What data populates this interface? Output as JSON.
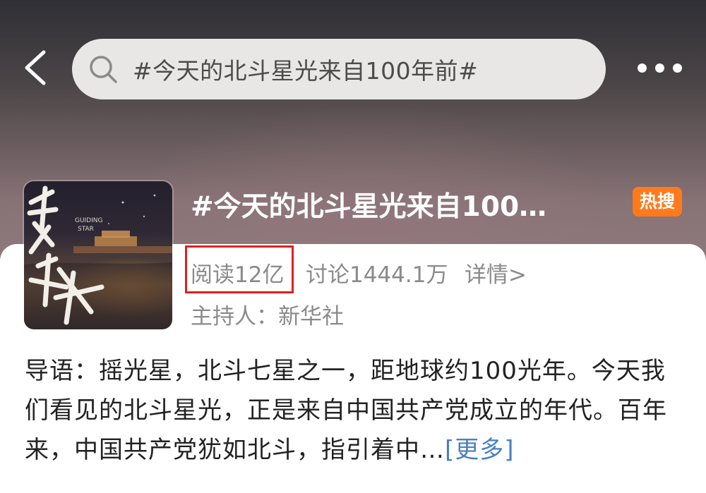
{
  "header": {
    "search_text": "#今天的北斗星光来自100年前#"
  },
  "topic": {
    "title": "#今天的北斗星光来自100…",
    "badge": "热搜",
    "reads": "阅读12亿",
    "discussions": "讨论1444.1万",
    "details_link": "详情>",
    "host": "主持人：新华社",
    "cover_text": {
      "brand_en_1": "GUIDING",
      "brand_en_2": "STAR"
    }
  },
  "intro": {
    "text": "导语：摇光星，北斗七星之一，距地球约100光年。今天我们看见的北斗星光，正是来自中国共产党成立的年代。百年来，中国共产党犹如北斗，指引着中…",
    "more_label": "[更多]"
  },
  "colors": {
    "badge": "#ff7a1a",
    "highlight_box": "#e02020",
    "link": "#4a7fbf"
  }
}
